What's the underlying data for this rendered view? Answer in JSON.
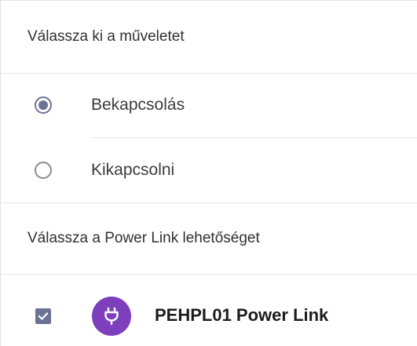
{
  "action_section": {
    "title": "Válassza ki a műveletet",
    "options": [
      {
        "label": "Bekapcsolás",
        "selected": true
      },
      {
        "label": "Kikapcsolni",
        "selected": false
      }
    ]
  },
  "device_section": {
    "title": "Válassza a Power Link lehetőséget",
    "devices": [
      {
        "name": "PEHPL01 Power Link",
        "checked": true,
        "icon": "plug-icon",
        "icon_color": "#7e3fbd"
      }
    ]
  },
  "colors": {
    "accent": "#6b7394",
    "device_icon_bg": "#7e3fbd"
  }
}
